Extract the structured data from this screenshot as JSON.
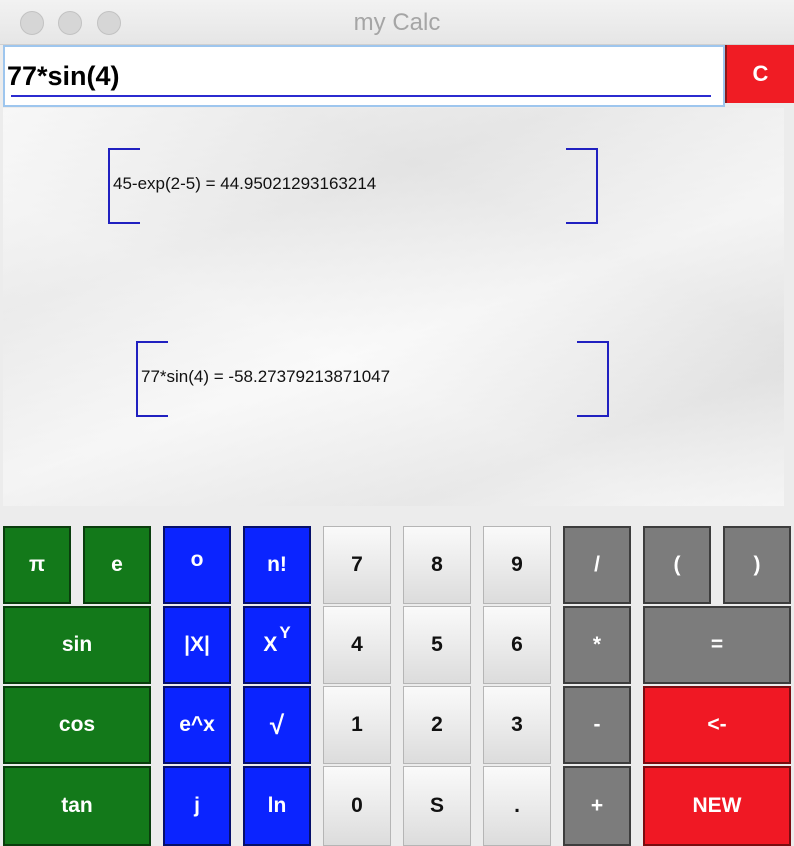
{
  "window": {
    "title": "my Calc"
  },
  "entry": {
    "value": "77*sin(4)"
  },
  "clear_label": "C",
  "history": [
    {
      "text": "45-exp(2-5) = 44.9502129316321​4"
    },
    {
      "text": "77*sin(4) = -58.27379213871047"
    }
  ],
  "keys": {
    "pi": "π",
    "e": "e",
    "deg": "o",
    "fact": "n!",
    "sin": "sin",
    "abs": "|X|",
    "pow_base": "X",
    "pow_exp": "Y",
    "cos": "cos",
    "exp": "e^x",
    "sqrt": "√",
    "tan": "tan",
    "j": "j",
    "ln": "ln",
    "n7": "7",
    "n8": "8",
    "n9": "9",
    "n4": "4",
    "n5": "5",
    "n6": "6",
    "n1": "1",
    "n2": "2",
    "n3": "3",
    "n0": "0",
    "s": "S",
    "dot": ".",
    "div": "/",
    "mul": "*",
    "sub": "-",
    "add": "+",
    "lparen": "(",
    "rparen": ")",
    "equals": "=",
    "backspace": "<-",
    "new": "NEW"
  }
}
